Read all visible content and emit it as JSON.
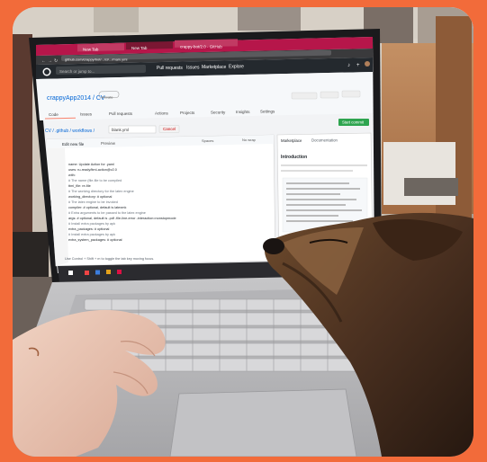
{
  "browser": {
    "tabs": [
      {
        "label": "New Tab"
      },
      {
        "label": "New Tab"
      },
      {
        "label": "crappy-bot/2.0 - GitHub"
      }
    ],
    "url": "github.com/crappy/bot/.../ci/.../main.yml",
    "search_placeholder": "Search or jump to...",
    "nav": [
      "Pull requests",
      "Issues",
      "Marketplace",
      "Explore"
    ]
  },
  "repo": {
    "name": "crappyApp2014 / CV",
    "visibility": "Private",
    "tabs": [
      "Code",
      "Issues",
      "Pull requests",
      "Actions",
      "Projects",
      "Security",
      "Insights",
      "Settings"
    ],
    "breadcrumb": "CV / .github / workflows /",
    "filename": "blank.yml",
    "cancel_label": "Cancel",
    "start_commit_label": "Start commit",
    "edit_tab": "Edit new file",
    "preview_tab": "Preview",
    "spaces_label": "Spaces",
    "nowrap_label": "No wrap"
  },
  "sidebar": {
    "tabs": [
      "Marketplace",
      "Documentation"
    ],
    "heading": "Introduction"
  },
  "code_lines": [
    "",
    "  ",
    "    name: Update Action for .yaml",
    "    uses: ru-ready/ttml-action@v2.0",
    "    with:",
    "      # The name (file-file to be compiled",
    "      ttml_file: re-file",
    "      # The working directory for the latex engine",
    "      working_directory: # optional",
    "      # The latex engine to be invoked",
    "      compiler: # optional, default is latexmk",
    "      # Extra arguments to be passed to the latex engine",
    "      args: # optional, default is -pdf -file-line-error -interaction=nonstopmode",
    "      # Install extra packages by apk",
    "      extra_packages: # optional",
    "      # Install extra packages by apk",
    "      extra_system_packages: # optional"
  ],
  "code_footer": "Use Control + Shift + m to toggle the tab key moving focus.",
  "colors": {
    "border": "#f26b3a",
    "tabbar": "#b6164a",
    "github_header": "#24292e",
    "commit_green": "#2ea44f"
  }
}
